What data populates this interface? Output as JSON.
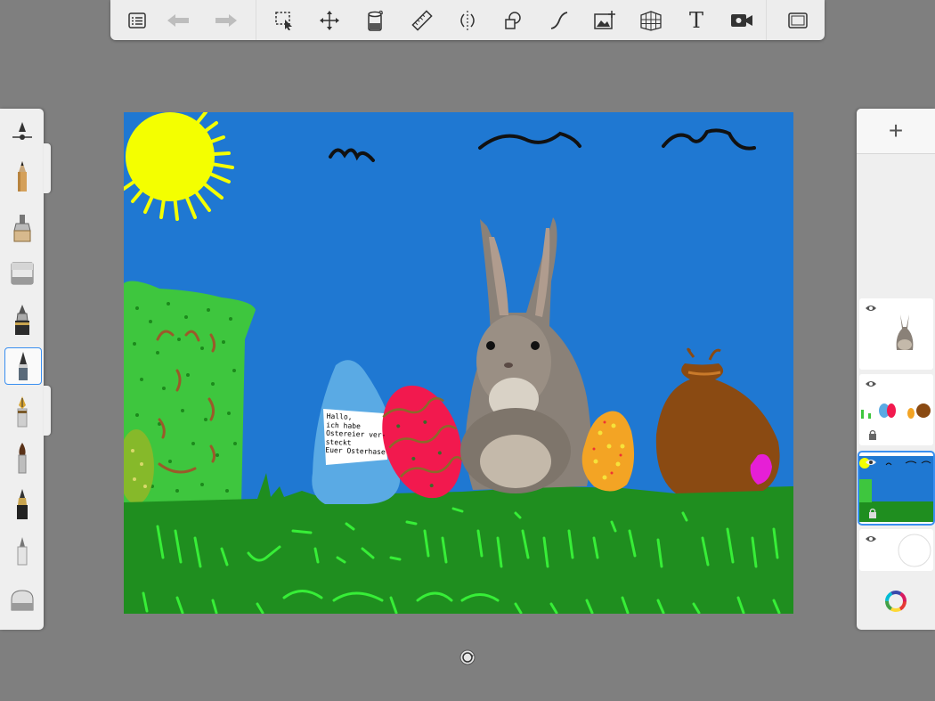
{
  "toolbar": {
    "items": [
      {
        "name": "layers-menu-icon"
      },
      {
        "name": "undo-icon"
      },
      {
        "name": "redo-icon"
      },
      {
        "name": "selection-icon"
      },
      {
        "name": "transform-icon"
      },
      {
        "name": "fill-bucket-icon"
      },
      {
        "name": "ruler-icon"
      },
      {
        "name": "symmetry-icon"
      },
      {
        "name": "shapes-icon"
      },
      {
        "name": "curve-icon"
      },
      {
        "name": "add-image-icon"
      },
      {
        "name": "perspective-grid-icon"
      },
      {
        "name": "text-icon"
      },
      {
        "name": "record-icon"
      },
      {
        "name": "fullscreen-icon"
      }
    ],
    "text_glyph": "T"
  },
  "left_panel": {
    "tools": [
      {
        "name": "brush-settings-icon"
      },
      {
        "name": "pencil-tool"
      },
      {
        "name": "marker-tool"
      },
      {
        "name": "eraser-tool"
      },
      {
        "name": "ink-pen-tool"
      },
      {
        "name": "ballpoint-tool",
        "selected": true
      },
      {
        "name": "fountain-pen-tool"
      },
      {
        "name": "paint-brush-tool"
      },
      {
        "name": "airbrush-tool"
      },
      {
        "name": "chisel-tool"
      },
      {
        "name": "smudge-tool"
      }
    ]
  },
  "right_panel": {
    "add_label": "+",
    "layers": [
      {
        "name": "layer-rabbit",
        "visible": true,
        "locked": false,
        "active": false
      },
      {
        "name": "layer-eggs",
        "visible": true,
        "locked": true,
        "active": false
      },
      {
        "name": "layer-background",
        "visible": true,
        "locked": true,
        "active": true
      },
      {
        "name": "layer-paper",
        "visible": true,
        "locked": false,
        "active": false
      }
    ]
  },
  "canvas": {
    "note_text": "Hallo,\nich habe\nOstereier ver-\nsteckt\nEuer Osterhase",
    "colors": {
      "sky": "#1f78d2",
      "grass": "#1f8e1f",
      "grass_strokes": "#37ee37",
      "sun": "#f4ff00",
      "hedge": "#3ec63e",
      "sack": "#8a4a12",
      "egg_red": "#f2194e",
      "egg_orange": "#f3a424",
      "egg_blue": "#5aaae4"
    }
  }
}
